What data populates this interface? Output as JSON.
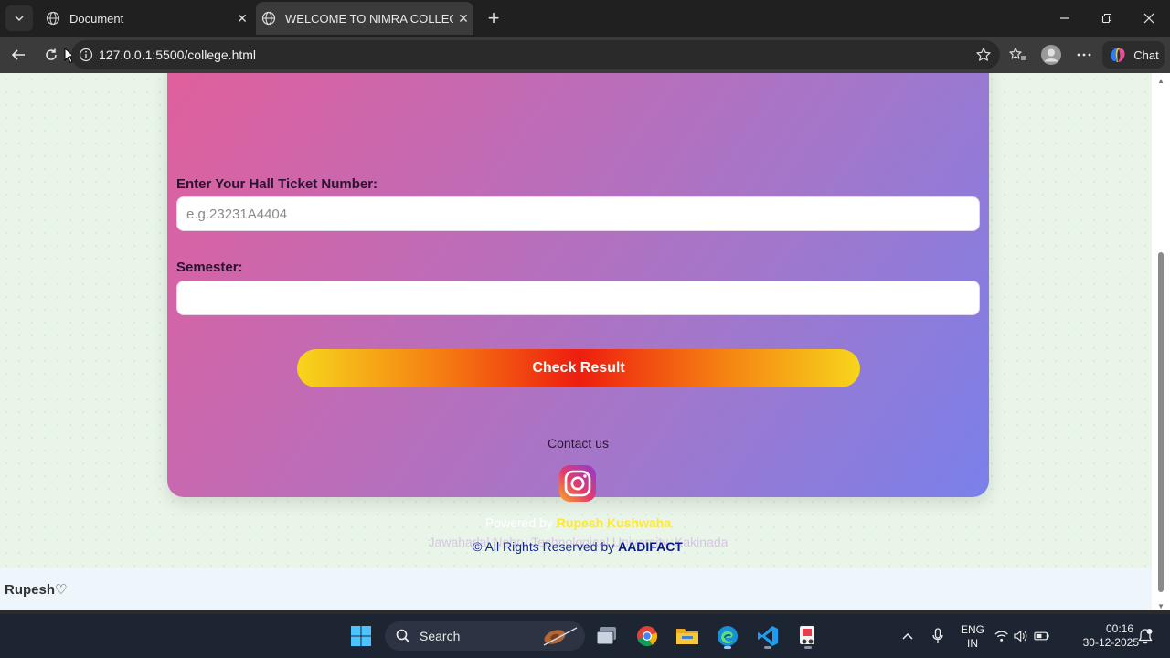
{
  "browser": {
    "tabs": [
      {
        "title": "Document",
        "active": false
      },
      {
        "title": "WELCOME TO NIMRA COLLEGE OF",
        "active": true
      }
    ],
    "url": "127.0.0.1:5500/college.html",
    "chat_label": "Chat"
  },
  "form": {
    "hall_ticket_label": "Enter Your Hall Ticket Number:",
    "hall_ticket_placeholder": "e.g.23231A4404",
    "hall_ticket_value": "",
    "semester_label": "Semester:",
    "semester_value": "",
    "submit_label": "Check Result"
  },
  "card_footer": {
    "contact_label": "Contact us",
    "powered_prefix": "Powered by ",
    "powered_name": "Rupesh Kushwaha",
    "university": "Jawaharlal Nehru Technological University, Kakinada"
  },
  "page_footer": {
    "copyright_prefix": "© All Rights Reserved by ",
    "copyright_brand": "AADIFACT",
    "signature": "Rupesh♡"
  },
  "taskbar": {
    "search_label": "Search",
    "lang_primary": "ENG",
    "lang_secondary": "IN",
    "time": "00:16",
    "date": "30-12-2025"
  },
  "colors": {
    "card_gradient_start": "#e15f9b",
    "card_gradient_end": "#7a80ea",
    "button_center": "#ee1d10",
    "button_edge": "#f7d51c",
    "powered_name": "#ffe833"
  }
}
